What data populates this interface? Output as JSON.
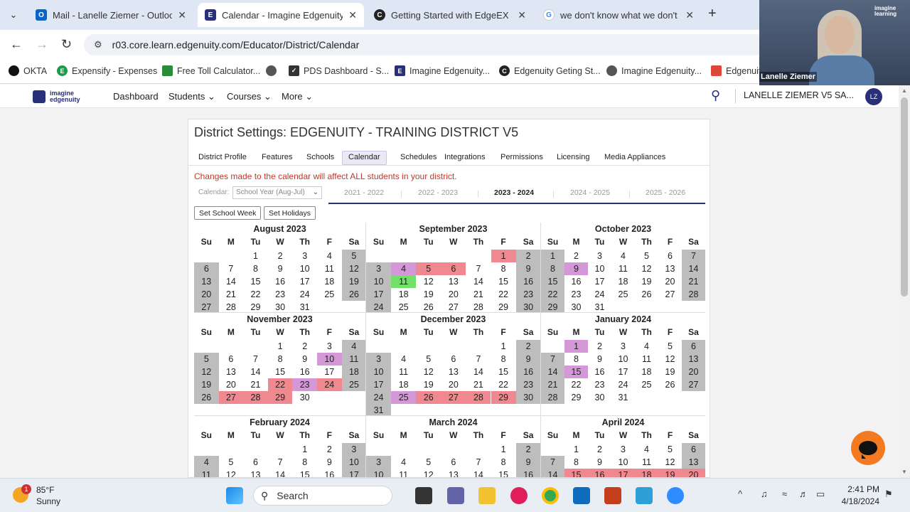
{
  "browser": {
    "tabs": [
      {
        "title": "Mail - Lanelle Ziemer - Outlook",
        "icon": "outlook-icon",
        "color": "#0a64c8",
        "glyph": "O"
      },
      {
        "title": "Calendar - Imagine Edgenuity",
        "icon": "edgenuity-icon",
        "color": "#2a2f7a",
        "glyph": "E"
      },
      {
        "title": "Getting Started with EdgeEX Sit",
        "icon": "edgenuity-c-icon",
        "color": "#222",
        "glyph": "C"
      },
      {
        "title": "we don't know what we don't k",
        "icon": "google-icon",
        "color": "#4285f4",
        "glyph": "G"
      }
    ],
    "url": "r03.core.learn.edgenuity.com/Educator/District/Calendar",
    "bookmarks": [
      {
        "label": "OKTA",
        "color": "#111"
      },
      {
        "label": "Expensify - Expenses",
        "color": "#1d9a4b"
      },
      {
        "label": "Free Toll Calculator...",
        "color": "#2a8c3a"
      },
      {
        "label": "",
        "color": "#555"
      },
      {
        "label": "PDS Dashboard - S...",
        "color": "#333"
      },
      {
        "label": "Imagine Edgenuity...",
        "color": "#2a2f7a"
      },
      {
        "label": "Edgenuity Geting St...",
        "color": "#222"
      },
      {
        "label": "Imagine Edgenuity...",
        "color": "#555"
      },
      {
        "label": "Edgenuit",
        "color": "#e0453a"
      }
    ]
  },
  "app": {
    "nav": [
      "Dashboard",
      "Students",
      "Courses",
      "More"
    ],
    "username": "LANELLE ZIEMER V5 SA...",
    "initials": "LZ"
  },
  "settings": {
    "title": "District Settings: EDGENUITY - TRAINING DISTRICT V5",
    "tabs": [
      "District Profile",
      "Features",
      "Schools",
      "Calendar",
      "Schedules",
      "Integrations",
      "Permissions",
      "Licensing",
      "Media Appliances"
    ],
    "active_tab": "Calendar",
    "warning": "Changes made to the calendar will affect ALL students in your district.",
    "calendar_label": "Calendar:",
    "calendar_select": "School Year (Aug-Jul)",
    "years": [
      "2021 - 2022",
      "2022 - 2023",
      "2023 - 2024",
      "2024 - 2025",
      "2025 - 2026"
    ],
    "active_year": "2023 - 2024",
    "buttons": [
      "Set School Week",
      "Set Holidays"
    ]
  },
  "calendar": {
    "weekdays": [
      "Su",
      "M",
      "Tu",
      "W",
      "Th",
      "F",
      "Sa"
    ],
    "months": [
      {
        "title": "August 2023",
        "start": 2,
        "days": 31,
        "pink": [],
        "purple": [],
        "green": []
      },
      {
        "title": "September 2023",
        "start": 5,
        "days": 30,
        "pink": [
          1,
          5,
          6
        ],
        "purple": [
          4
        ],
        "green": [
          11
        ]
      },
      {
        "title": "October 2023",
        "start": 0,
        "days": 31,
        "pink": [],
        "purple": [
          9
        ],
        "green": []
      },
      {
        "title": "November 2023",
        "start": 3,
        "days": 30,
        "pink": [
          22,
          24,
          27,
          28,
          29
        ],
        "purple": [
          10,
          23
        ],
        "green": []
      },
      {
        "title": "December 2023",
        "start": 5,
        "days": 31,
        "pink": [
          26,
          27,
          28,
          29
        ],
        "purple": [
          25
        ],
        "green": []
      },
      {
        "title": "January 2024",
        "start": 1,
        "days": 31,
        "pink": [],
        "purple": [
          1,
          15
        ],
        "green": []
      },
      {
        "title": "February 2024",
        "start": 4,
        "days": 29,
        "pink": [],
        "purple": [],
        "green": []
      },
      {
        "title": "March 2024",
        "start": 5,
        "days": 31,
        "pink": [],
        "purple": [],
        "green": []
      },
      {
        "title": "April 2024",
        "start": 1,
        "days": 30,
        "pink": [
          15,
          16,
          17,
          18,
          19,
          20
        ],
        "purple": [],
        "green": []
      }
    ]
  },
  "video": {
    "name": "Lanelle Ziemer",
    "logo": "imagine learning"
  },
  "taskbar": {
    "temp": "85°F",
    "weather": "Sunny",
    "badge": "1",
    "search": "Search",
    "time": "2:41 PM",
    "date": "4/18/2024"
  }
}
